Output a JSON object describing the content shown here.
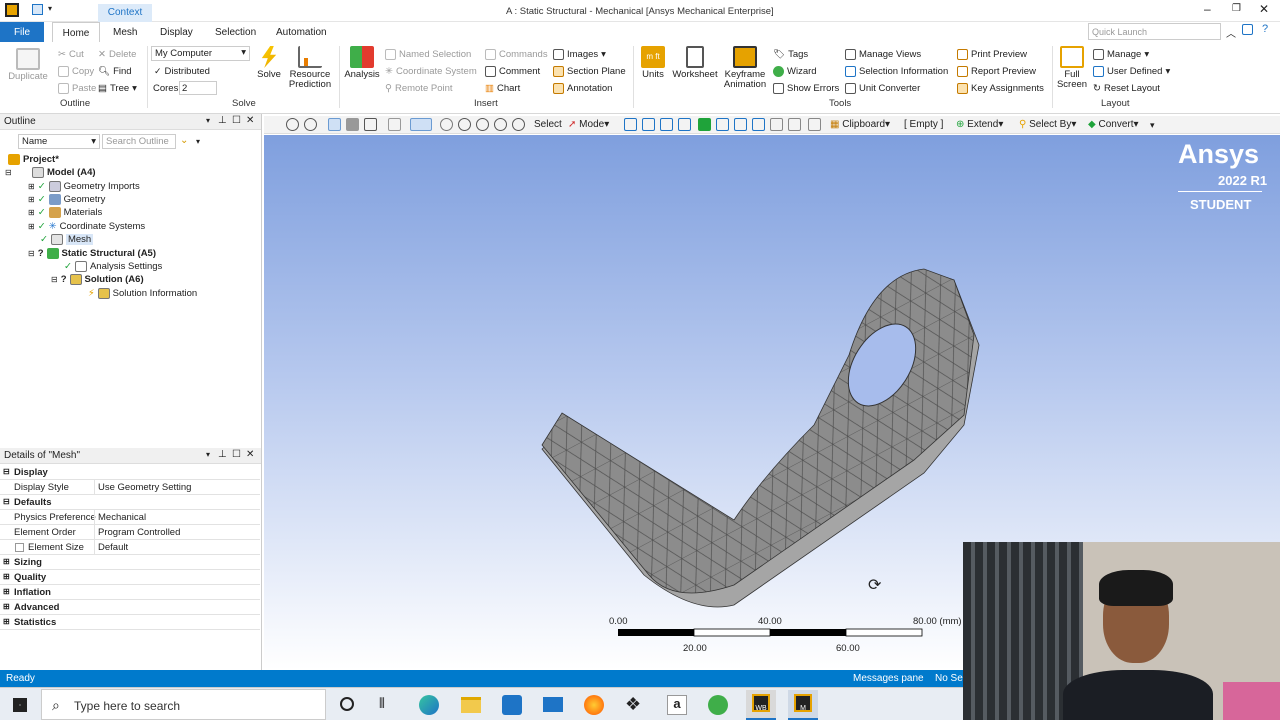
{
  "window": {
    "title": "A : Static Structural - Mechanical [Ansys Mechanical Enterprise]",
    "context_tab": "Context",
    "quick_launch_placeholder": "Quick Launch"
  },
  "ribbon_tabs": [
    {
      "label": "File"
    },
    {
      "label": "Home"
    },
    {
      "label": "Mesh"
    },
    {
      "label": "Display"
    },
    {
      "label": "Selection"
    },
    {
      "label": "Automation"
    }
  ],
  "ribbon": {
    "outline_group": {
      "label": "Outline",
      "duplicate": "Duplicate",
      "cut": "Cut",
      "copy": "Copy",
      "paste": "Paste",
      "delete": "Delete",
      "find": "Find",
      "tree": "Tree"
    },
    "solve_group": {
      "label": "Solve",
      "solver_target": "My Computer",
      "distributed": "Distributed",
      "cores_label": "Cores",
      "cores_value": "2",
      "solve": "Solve",
      "resource_prediction_1": "Resource",
      "resource_prediction_2": "Prediction"
    },
    "insert_group": {
      "label": "Insert",
      "analysis": "Analysis",
      "named_selection": "Named Selection",
      "coordinate_system": "Coordinate System",
      "remote_point": "Remote Point",
      "commands": "Commands",
      "comment": "Comment",
      "chart": "Chart",
      "images": "Images",
      "section_plane": "Section Plane",
      "annotation": "Annotation"
    },
    "tools_group": {
      "label": "Tools",
      "units": "Units",
      "worksheet": "Worksheet",
      "keyframe_1": "Keyframe",
      "keyframe_2": "Animation",
      "tags": "Tags",
      "wizard": "Wizard",
      "show_errors": "Show Errors",
      "manage_views": "Manage Views",
      "selection_information": "Selection Information",
      "unit_converter": "Unit Converter",
      "print_preview": "Print Preview",
      "report_preview": "Report Preview",
      "key_assignments": "Key Assignments"
    },
    "layout_group": {
      "label": "Layout",
      "full_screen_1": "Full",
      "full_screen_2": "Screen",
      "manage": "Manage",
      "user_defined": "User Defined",
      "reset_layout": "Reset Layout"
    }
  },
  "graphics_toolbar": {
    "select": "Select",
    "mode": "Mode",
    "clipboard": "Clipboard",
    "empty": "[ Empty ]",
    "extend": "Extend",
    "select_by": "Select By",
    "convert": "Convert"
  },
  "outline": {
    "title": "Outline",
    "name_filter": "Name",
    "search_placeholder": "Search Outline",
    "tree": [
      {
        "label": "Project*",
        "bold": true
      },
      {
        "label": "Model (A4)",
        "bold": true
      },
      {
        "label": "Geometry Imports"
      },
      {
        "label": "Geometry"
      },
      {
        "label": "Materials"
      },
      {
        "label": "Coordinate Systems"
      },
      {
        "label": "Mesh",
        "selected": true
      },
      {
        "label": "Static Structural (A5)",
        "bold": true
      },
      {
        "label": "Analysis Settings"
      },
      {
        "label": "Solution (A6)",
        "bold": true
      },
      {
        "label": "Solution Information"
      }
    ]
  },
  "details": {
    "title": "Details of \"Mesh\"",
    "rows": [
      {
        "key": "Display",
        "section": true
      },
      {
        "key": "Display Style",
        "value": "Use Geometry Setting"
      },
      {
        "key": "Defaults",
        "section": true
      },
      {
        "key": "Physics Preference",
        "value": "Mechanical"
      },
      {
        "key": "Element Order",
        "value": "Program Controlled"
      },
      {
        "key": "Element Size",
        "value": "Default"
      },
      {
        "key": "Sizing",
        "section": true
      },
      {
        "key": "Quality",
        "section": true
      },
      {
        "key": "Inflation",
        "section": true
      },
      {
        "key": "Advanced",
        "section": true
      },
      {
        "key": "Statistics",
        "section": true
      }
    ]
  },
  "viewport": {
    "brand": "Ansys",
    "version": "2022 R1",
    "edition": "STUDENT",
    "scale_labels_top": [
      "0.00",
      "40.00",
      "80.00 (mm)"
    ],
    "scale_labels_bottom": [
      "20.00",
      "60.00"
    ]
  },
  "status": {
    "ready": "Ready",
    "messages_pane": "Messages pane",
    "no_selection": "No Sel"
  },
  "taskbar": {
    "search_placeholder": "Type here to search",
    "wb_label": "WB",
    "m_label": "M"
  },
  "colors": {
    "accent": "#007acc",
    "file_tab": "#1e74c6",
    "viewport_top": "#7f9fde",
    "viewport_bottom": "#ffffff"
  }
}
